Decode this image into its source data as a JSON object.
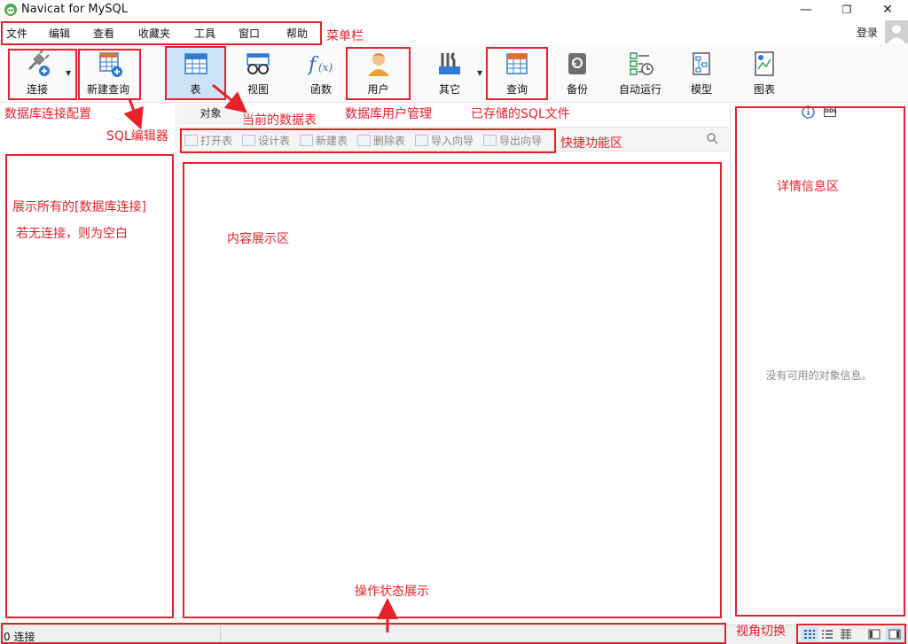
{
  "window": {
    "title": "Navicat for MySQL",
    "controls": {
      "minimize": "—",
      "maximize": "❐",
      "close": "✕"
    }
  },
  "menu": {
    "items": [
      "文件",
      "编辑",
      "查看",
      "收藏夹",
      "工具",
      "窗口",
      "帮助"
    ],
    "login": "登录"
  },
  "toolbar": {
    "connect": "连接",
    "new_query": "新建查询",
    "table": "表",
    "view": "视图",
    "function": "函数",
    "user": "用户",
    "other": "其它",
    "query": "查询",
    "backup": "备份",
    "automation": "自动运行",
    "model": "模型",
    "chart": "图表"
  },
  "tabs": {
    "objects": "对象"
  },
  "quick_actions": [
    "打开表",
    "设计表",
    "新建表",
    "删除表",
    "导入向导",
    "导出向导"
  ],
  "info_panel": {
    "empty_text": "没有可用的对象信息。",
    "ddl_label": "DDL"
  },
  "status": {
    "text": "0 连接"
  },
  "annotations": {
    "menubar": "菜单栏",
    "connection_config": "数据库连接配置",
    "sql_editor": "SQL编辑器",
    "current_tables": "当前的数据表",
    "user_management": "数据库用户管理",
    "saved_sql": "已存储的SQL文件",
    "quick_function_area": "快捷功能区",
    "left_line1": "展示所有的[数据库连接]",
    "left_line2": "若无连接，则为空白",
    "content_area": "内容展示区",
    "detail_area": "详情信息区",
    "status_display": "操作状态展示",
    "view_switch": "视角切换"
  },
  "colors": {
    "annotation": "#e8212b",
    "accent": "#2f7bd6",
    "selected_tool": "#cde3f7"
  }
}
